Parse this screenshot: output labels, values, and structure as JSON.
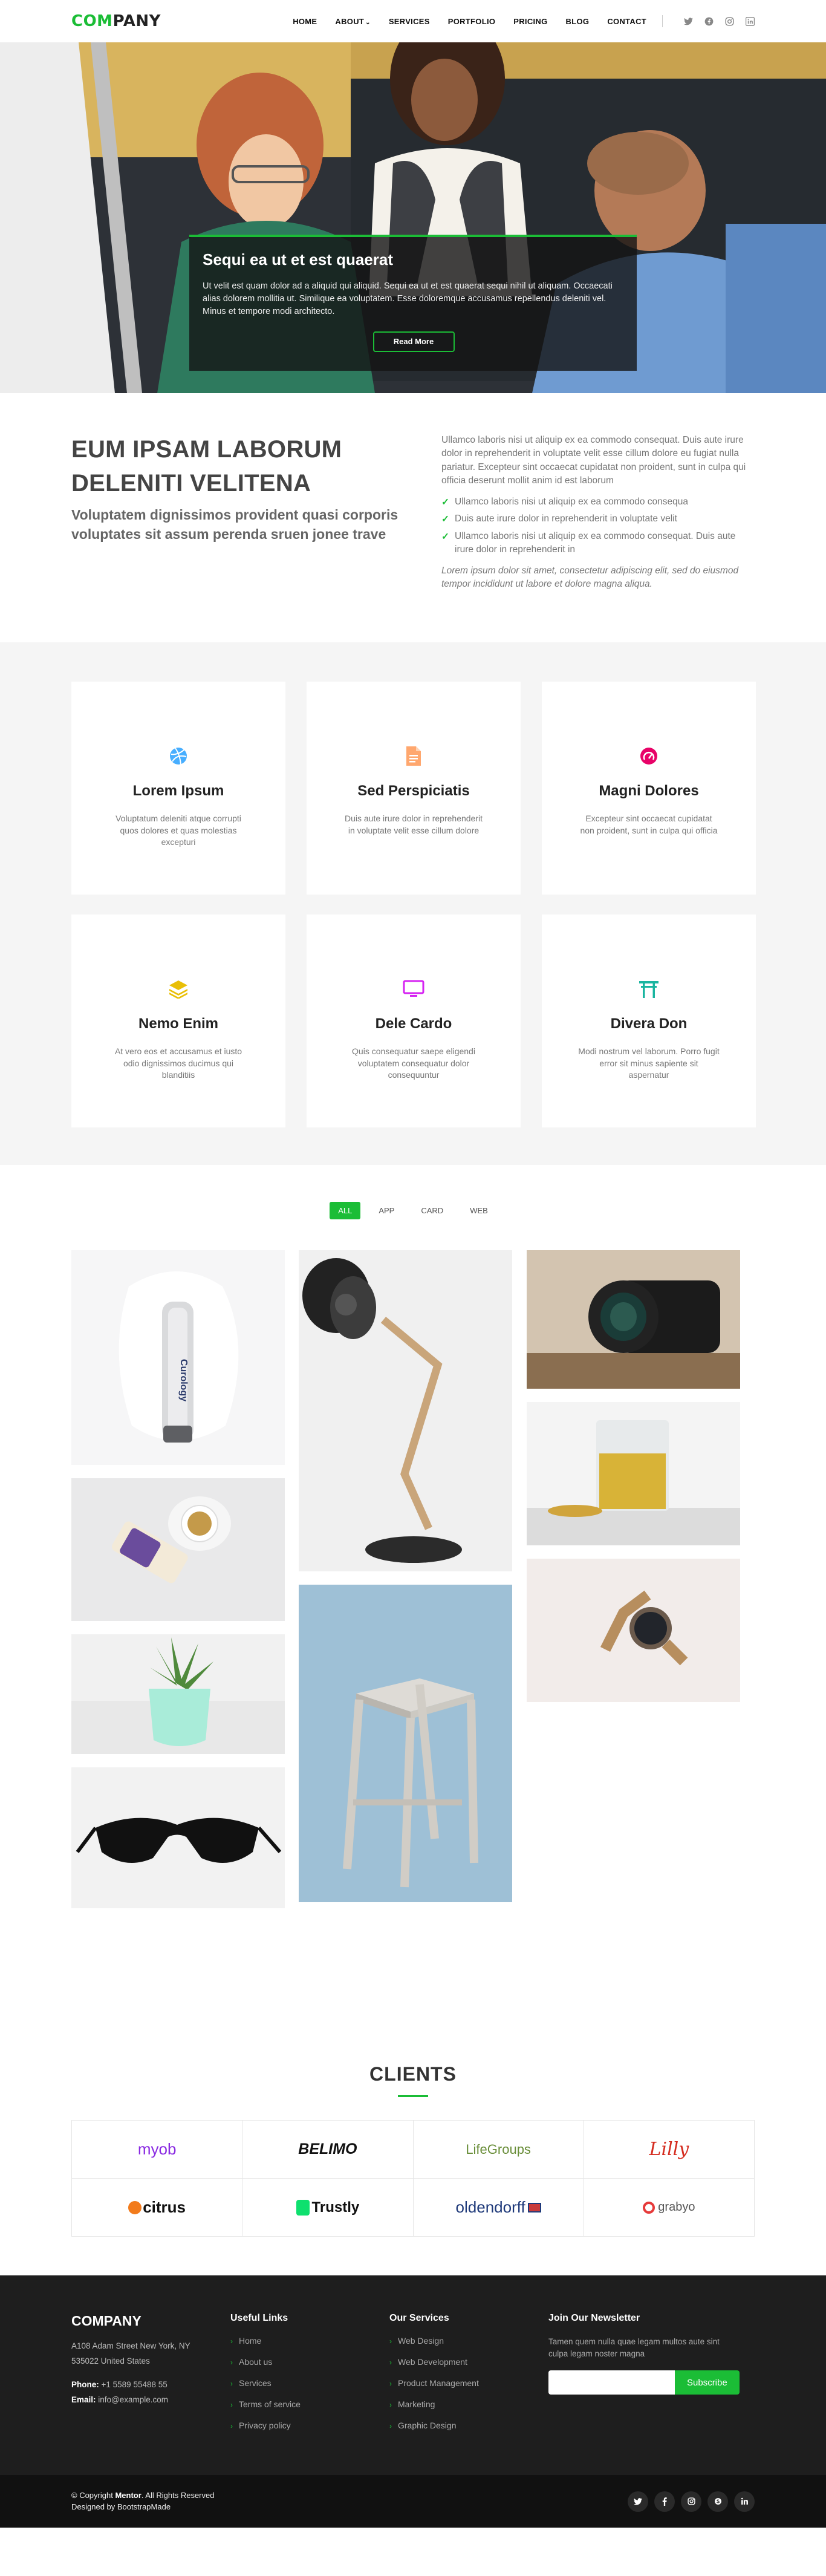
{
  "header": {
    "logo_accent": "COM",
    "logo_rest": "PANY",
    "nav": [
      {
        "label": "HOME"
      },
      {
        "label": "ABOUT"
      },
      {
        "label": "SERVICES"
      },
      {
        "label": "PORTFOLIO"
      },
      {
        "label": "PRICING"
      },
      {
        "label": "BLOG"
      },
      {
        "label": "CONTACT"
      }
    ],
    "social_icons": [
      "twitter-icon",
      "facebook-icon",
      "instagram-icon",
      "linkedin-icon"
    ]
  },
  "hero": {
    "title": "Sequi ea ut et est quaerat",
    "text": "Ut velit est quam dolor ad a aliquid qui aliquid. Sequi ea ut et est quaerat sequi nihil ut aliquam. Occaecati alias dolorem mollitia ut. Similique ea voluptatem. Esse doloremque accusamus repellendus deleniti vel. Minus et tempore modi architecto.",
    "button": "Read More"
  },
  "about": {
    "heading": "EUM IPSAM LABORUM DELENITI VELITENA",
    "subheading": "Voluptatem dignissimos provident quasi corporis voluptates sit assum perenda sruen jonee trave",
    "intro": "Ullamco laboris nisi ut aliquip ex ea commodo consequat. Duis aute irure dolor in reprehenderit in voluptate velit esse cillum dolore eu fugiat nulla pariatur. Excepteur sint occaecat cupidatat non proident, sunt in culpa qui officia deserunt mollit anim id est laborum",
    "checks": [
      "Ullamco laboris nisi ut aliquip ex ea commodo consequa",
      "Duis aute irure dolor in reprehenderit in voluptate velit",
      "Ullamco laboris nisi ut aliquip ex ea commodo consequat. Duis aute irure dolor in reprehenderit in"
    ],
    "italic": "Lorem ipsum dolor sit amet, consectetur adipiscing elit, sed do eiusmod tempor incididunt ut labore et dolore magna aliqua."
  },
  "services": [
    {
      "icon": "dribbble-icon",
      "color": "#47aeff",
      "title": "Lorem Ipsum",
      "desc": "Voluptatum deleniti atque corrupti quos dolores et quas molestias excepturi"
    },
    {
      "icon": "file-icon",
      "color": "#ffa76e",
      "title": "Sed Perspiciatis",
      "desc": "Duis aute irure dolor in reprehenderit in voluptate velit esse cillum dolore"
    },
    {
      "icon": "tachometer-icon",
      "color": "#e9bf06",
      "title": "Magni Dolores",
      "desc": "Excepteur sint occaecat cupidatat non proident, sunt in culpa qui officia"
    },
    {
      "icon": "layers-icon",
      "color": "#e9bf06",
      "title": "Nemo Enim",
      "desc": "At vero eos et accusamus et iusto odio dignissimos ducimus qui blanditiis"
    },
    {
      "icon": "monitor-icon",
      "color": "#d6ff22",
      "title": "Dele Cardo",
      "desc": "Quis consequatur saepe eligendi voluptatem consequatur dolor consequuntur"
    },
    {
      "icon": "gate-icon",
      "color": "#4680ff",
      "title": "Divera Don",
      "desc": "Modi nostrum vel laborum. Porro fugit error sit minus sapiente sit aspernatur"
    }
  ],
  "portfolio": {
    "filters": [
      "ALL",
      "APP",
      "CARD",
      "WEB"
    ],
    "bottle_label": "Curology"
  },
  "clients": {
    "title": "CLIENTS",
    "logos": [
      {
        "name": "myob",
        "color": "#8a2be2"
      },
      {
        "name": "BELIMO",
        "color": "#111111"
      },
      {
        "name": "LifeGroups",
        "color": "#6a8e3a"
      },
      {
        "name": "Lilly",
        "color": "#d52b1e"
      },
      {
        "name": "citrus",
        "color": "#111111"
      },
      {
        "name": "Trustly",
        "color": "#111111"
      },
      {
        "name": "oldendorff",
        "color": "#1f3a7a"
      },
      {
        "name": "grabyo",
        "color": "#555555"
      }
    ]
  },
  "footer": {
    "brand": "COMPANY",
    "address1": "A108 Adam Street New York, NY",
    "address2": "535022 United States",
    "phone_label": "Phone:",
    "phone": "+1 5589 55488 55",
    "email_label": "Email:",
    "email": "info@example.com",
    "useful_heading": "Useful Links",
    "useful_links": [
      "Home",
      "About us",
      "Services",
      "Terms of service",
      "Privacy policy"
    ],
    "services_heading": "Our Services",
    "services_links": [
      "Web Design",
      "Web Development",
      "Product Management",
      "Marketing",
      "Graphic Design"
    ],
    "newsletter_heading": "Join Our Newsletter",
    "newsletter_text": "Tamen quem nulla quae legam multos aute sint culpa legam noster magna",
    "subscribe": "Subscribe",
    "copyright_pre": "© Copyright",
    "copyright_brand": "Mentor",
    "copyright_post": ". All Rights Reserved",
    "designed": "Designed by BootstrapMade",
    "social_icons": [
      "twitter-icon",
      "facebook-icon",
      "instagram-icon",
      "skype-icon",
      "linkedin-icon"
    ]
  }
}
